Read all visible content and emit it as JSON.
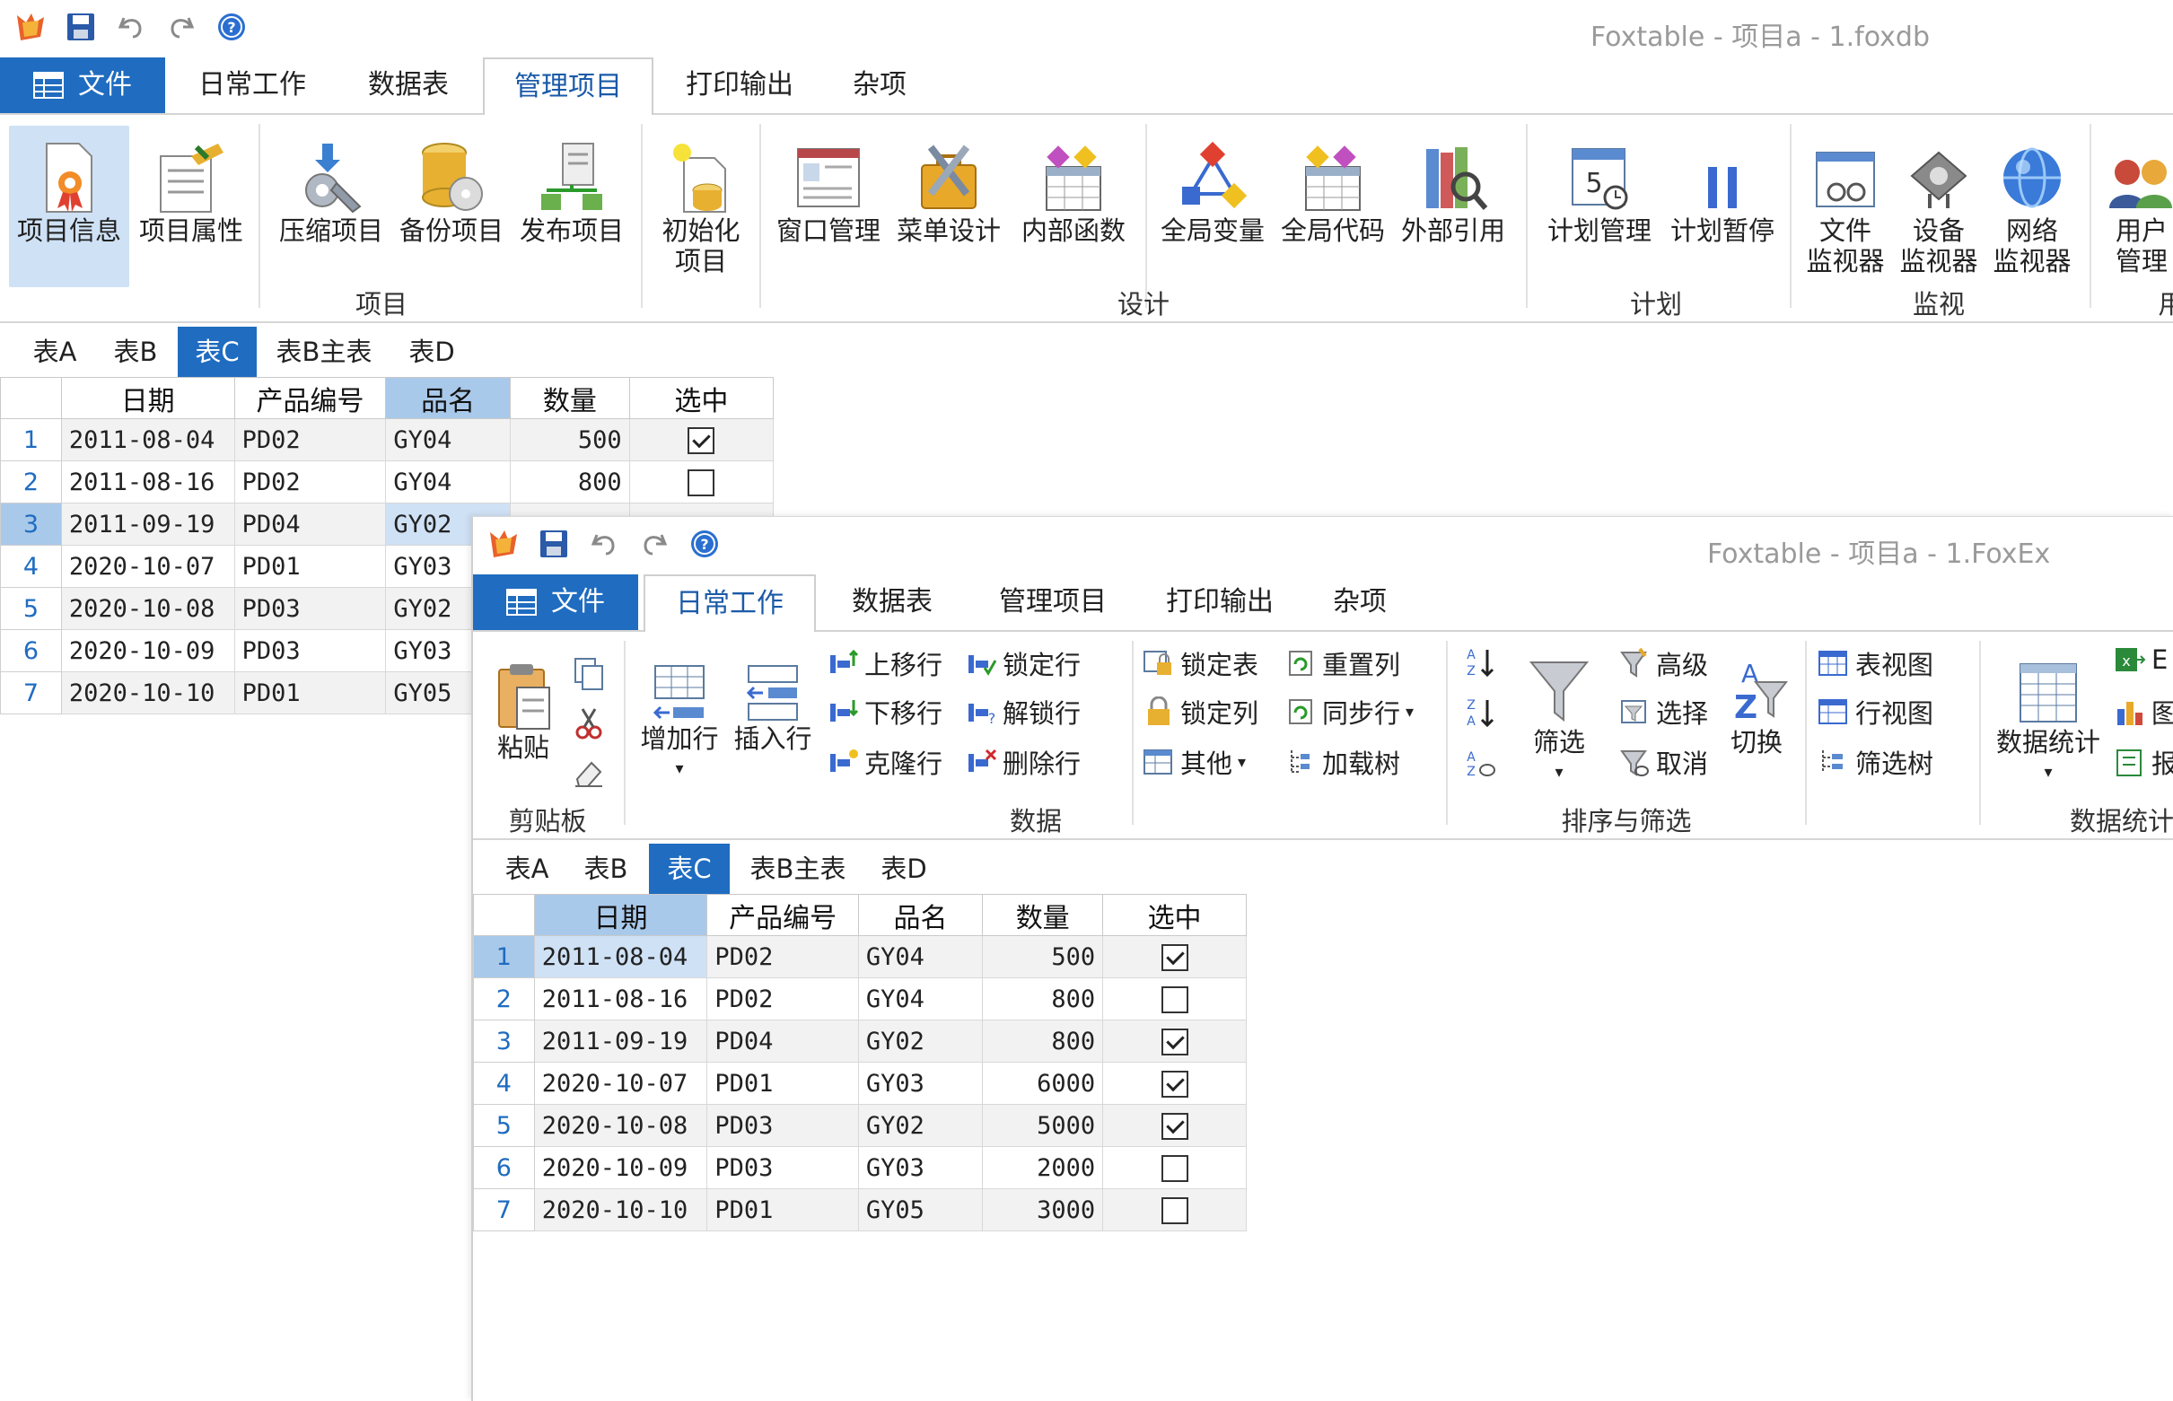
{
  "windowA": {
    "title": "Foxtable - 项目a - 1.foxdb",
    "menu": [
      "文件",
      "日常工作",
      "数据表",
      "管理项目",
      "打印输出",
      "杂项"
    ],
    "ribbon": {
      "buttons": [
        "项目信息",
        "项目属性",
        "压缩项目",
        "备份项目",
        "发布项目",
        "初始化项目",
        "窗口管理",
        "菜单设计",
        "内部函数",
        "全局变量",
        "全局代码",
        "外部引用",
        "计划管理",
        "计划暂停",
        "文件监视器",
        "设备监视器",
        "网络监视器",
        "用户管理"
      ],
      "init_line1": "初始化",
      "init_line2": "项目",
      "fm1": "文件",
      "fm2": "监视器",
      "dm1": "设备",
      "dm2": "监视器",
      "nm1": "网络",
      "nm2": "监视器",
      "um1": "用户",
      "um2": "管理",
      "groups": [
        "项目",
        "设计",
        "计划",
        "监视",
        "用"
      ]
    },
    "tabs": [
      "表A",
      "表B",
      "表C",
      "表B主表",
      "表D"
    ],
    "columns": [
      "日期",
      "产品编号",
      "品名",
      "数量",
      "选中"
    ],
    "rows": [
      {
        "n": "1",
        "date": "2011-08-04",
        "code": "PD02",
        "name": "GY04",
        "qty": "500",
        "checked": true
      },
      {
        "n": "2",
        "date": "2011-08-16",
        "code": "PD02",
        "name": "GY04",
        "qty": "800",
        "checked": false
      },
      {
        "n": "3",
        "date": "2011-09-19",
        "code": "PD04",
        "name": "GY02"
      },
      {
        "n": "4",
        "date": "2020-10-07",
        "code": "PD01",
        "name": "GY03"
      },
      {
        "n": "5",
        "date": "2020-10-08",
        "code": "PD03",
        "name": "GY02"
      },
      {
        "n": "6",
        "date": "2020-10-09",
        "code": "PD03",
        "name": "GY03"
      },
      {
        "n": "7",
        "date": "2020-10-10",
        "code": "PD01",
        "name": "GY05"
      }
    ]
  },
  "windowB": {
    "title": "Foxtable - 项目a - 1.FoxEx",
    "menu": [
      "文件",
      "日常工作",
      "数据表",
      "管理项目",
      "打印输出",
      "杂项"
    ],
    "ribbon": {
      "paste": "粘贴",
      "add_row": "增加行",
      "insert_row": "插入行",
      "move_up": "上移行",
      "move_down": "下移行",
      "clone_row": "克隆行",
      "lock_row": "锁定行",
      "unlock_row": "解锁行",
      "delete_row": "删除行",
      "lock_table": "锁定表",
      "lock_col": "锁定列",
      "other": "其他",
      "reset_col": "重置列",
      "sync_row": "同步行",
      "load_tree": "加载树",
      "filter": "筛选",
      "advanced": "高级",
      "select": "选择",
      "cancel": "取消",
      "toggle": "切换",
      "table_view": "表视图",
      "row_view": "行视图",
      "filter_tree": "筛选树",
      "data_stats": "数据统计",
      "excel_cut": "E",
      "chart_cut": "图",
      "report_cut": "报",
      "groups": [
        "剪贴板",
        "数据",
        "排序与筛选",
        "数据统计"
      ]
    },
    "tabs": [
      "表A",
      "表B",
      "表C",
      "表B主表",
      "表D"
    ],
    "columns": [
      "日期",
      "产品编号",
      "品名",
      "数量",
      "选中"
    ],
    "rows": [
      {
        "n": "1",
        "date": "2011-08-04",
        "code": "PD02",
        "name": "GY04",
        "qty": "500",
        "checked": true
      },
      {
        "n": "2",
        "date": "2011-08-16",
        "code": "PD02",
        "name": "GY04",
        "qty": "800",
        "checked": false
      },
      {
        "n": "3",
        "date": "2011-09-19",
        "code": "PD04",
        "name": "GY02",
        "qty": "800",
        "checked": true
      },
      {
        "n": "4",
        "date": "2020-10-07",
        "code": "PD01",
        "name": "GY03",
        "qty": "6000",
        "checked": true
      },
      {
        "n": "5",
        "date": "2020-10-08",
        "code": "PD03",
        "name": "GY02",
        "qty": "5000",
        "checked": true
      },
      {
        "n": "6",
        "date": "2020-10-09",
        "code": "PD03",
        "name": "GY03",
        "qty": "2000",
        "checked": false
      },
      {
        "n": "7",
        "date": "2020-10-10",
        "code": "PD01",
        "name": "GY05",
        "qty": "3000",
        "checked": false
      }
    ]
  },
  "colors": {
    "accent": "#1f6cc0",
    "header_highlight": "#a9c9ea",
    "selection": "#cfe1f5"
  }
}
